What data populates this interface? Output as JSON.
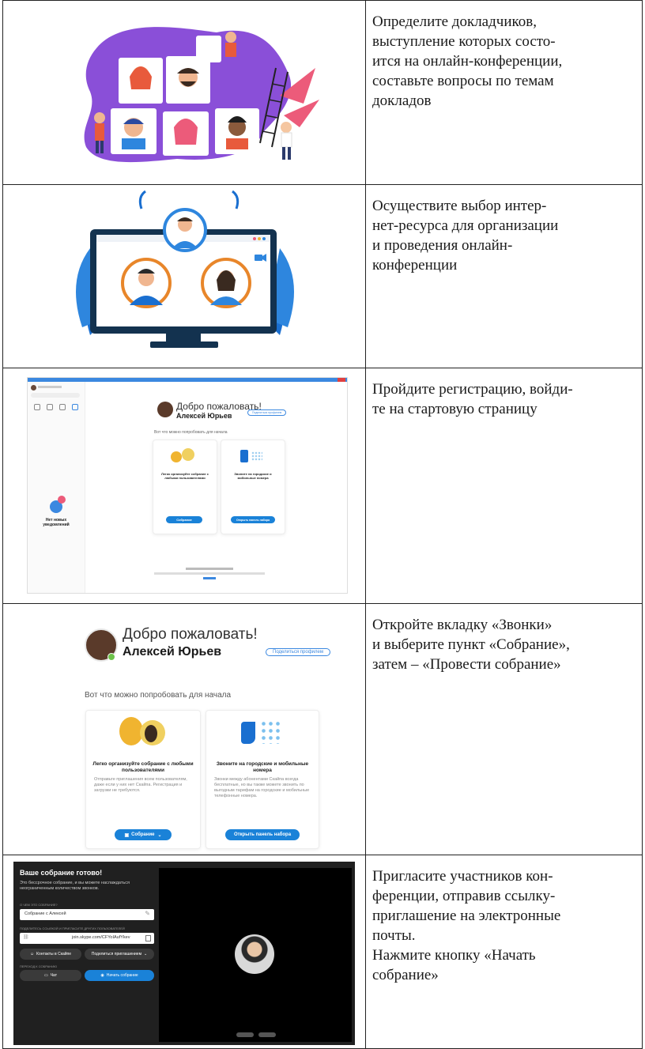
{
  "steps": [
    "Определите докладчиков,\nвыступление которых состо-\nится на онлайн-конференции,\nсоставьте вопросы по темам\nдокладов",
    "Осуществите выбор интер-\nнет-ресурса для организации\nи проведения онлайн-\nконференции",
    "Пройдите регистрацию, войди-\nте на стартовую страницу",
    "Откройте вкладку «Звонки»\nи выберите пункт «Собрание»,\nзатем – «Провести собрание»",
    "Пригласите участников кон-\nференции, отправив ссылку-\nприглашение на электронные\nпочты.\nНажмите кнопку «Начать\nсобрание»"
  ],
  "skype_small": {
    "greeting": "Добро пожаловать!",
    "user": "Алексей Юрьев",
    "share": "Поделиться профилем",
    "try": "Вот что можно попробовать для начала",
    "no_notifications": "Нет новых уведомлений",
    "card1": "Легко организуйте собрание с любыми пользователями",
    "card2": "Звоните на городские и мобильные номера",
    "btn1": "Собрание",
    "btn2": "Открыть панель набора"
  },
  "skype_large": {
    "greeting": "Добро пожаловать!",
    "user": "Алексей Юрьев",
    "share": "Поделиться профилем",
    "try": "Вот что можно попробовать для начала",
    "card1_title": "Легко организуйте собрание с любыми пользователями",
    "card1_text": "Отправьте приглашения всем пользователям, даже если у них нет Скайпа. Регистрация и загрузки не требуются.",
    "card2_title": "Звоните на городские и мобильные номера",
    "card2_text": "Звонки между абонентами Скайпа всегда бесплатные, но вы также можете звонить по выгодным тарифам на городские и мобильные телефонные номера.",
    "btn1": "Собрание",
    "btn2": "Открыть панель набора"
  },
  "meeting": {
    "title": "Ваше собрание готово!",
    "subtitle": "Это бессрочное собрание, и вы можете наслаждаться неограниченным количеством звонков.",
    "about_label": "О ЧЕМ ЭТО СОБРАНИЕ?",
    "about_value": "Собрание с Алексей",
    "share_label": "ПОДЕЛИТЕСЬ ССЫЛКОЙ И ПРИГЛАСИТЕ ДРУГИХ ПОЛЬЗОВАТЕЛЕЙ",
    "link": "join.skype.com/CFYoIAufYkev",
    "contacts_btn": "Контакты в Скайпе",
    "share_btn": "Поделиться приглашением",
    "goto_label": "ПЕРЕХОД К СОБРАНИЮ",
    "chat_btn": "Чат",
    "start_btn": "Начать собрание"
  },
  "colors": {
    "skype_blue": "#1a82d8",
    "purple": "#8a4fd8",
    "navy": "#13324f",
    "orange": "#e8862a",
    "dark_panel": "#2b2b2b"
  }
}
